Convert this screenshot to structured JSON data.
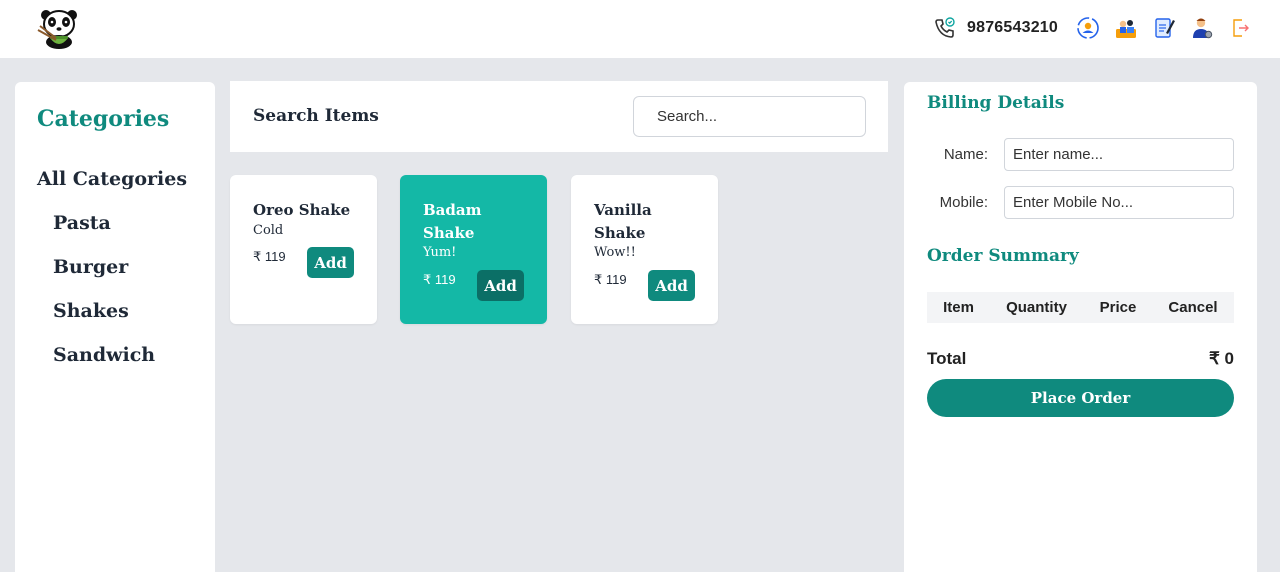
{
  "header": {
    "phone": "9876543210",
    "icons": [
      "phone-icon",
      "user-sync-icon",
      "team-icon",
      "notes-icon",
      "admin-user-icon",
      "logout-icon"
    ]
  },
  "categories": {
    "title": "Categories",
    "all_label": "All Categories",
    "items": [
      "Pasta",
      "Burger",
      "Shakes",
      "Sandwich"
    ]
  },
  "search": {
    "label": "Search Items",
    "placeholder": "Search..."
  },
  "items": [
    {
      "name": "Oreo Shake",
      "desc": "Cold",
      "price": "₹ 119",
      "button": "Add",
      "selected": false
    },
    {
      "name": "Badam Shake",
      "desc": "Yum!",
      "price": "₹ 119",
      "button": "Add",
      "selected": true
    },
    {
      "name": "Vanilla Shake",
      "desc": "Wow!!",
      "price": "₹ 119",
      "button": "Add",
      "selected": false
    }
  ],
  "billing": {
    "title": "Billing Details",
    "name_label": "Name:",
    "name_placeholder": "Enter name...",
    "mobile_label": "Mobile:",
    "mobile_placeholder": "Enter Mobile No..."
  },
  "order": {
    "title": "Order Summary",
    "columns": [
      "Item",
      "Quantity",
      "Price",
      "Cancel"
    ],
    "total_label": "Total",
    "total_value": "₹ 0",
    "place_label": "Place Order"
  },
  "colors": {
    "accent": "#0f8a7e",
    "selected_card": "#14b8a6",
    "background": "#e5e7eb"
  }
}
